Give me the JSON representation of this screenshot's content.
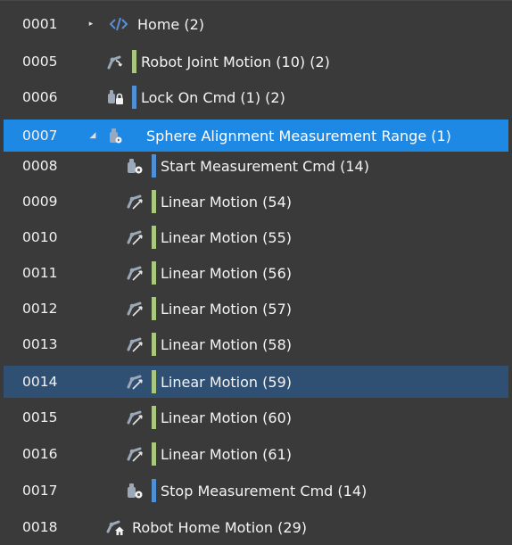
{
  "tree": {
    "rows": [
      {
        "line": "0001",
        "label": "Home (2)",
        "icon": "code-tag-icon",
        "expander": "collapsed",
        "bar_color": ""
      },
      {
        "line": "0005",
        "label": "Robot Joint Motion (10) (2)",
        "icon": "joint-motion-icon",
        "expander": "",
        "bar_color": "#a9c77f"
      },
      {
        "line": "0006",
        "label": "Lock On Cmd (1) (2)",
        "icon": "lock-cmd-icon",
        "expander": "",
        "bar_color": "#4f8fd6"
      },
      {
        "line": "0007",
        "label": "Sphere Alignment Measurement Range (1)",
        "icon": "measurement-range-icon",
        "expander": "expanded",
        "bar_color": "#1e88e5",
        "state": "selected"
      },
      {
        "line": "0008",
        "label": "Start Measurement Cmd (14)",
        "icon": "measurement-cmd-icon",
        "expander": "",
        "bar_color": "#4f8fd6"
      },
      {
        "line": "0009",
        "label": "Linear Motion (54)",
        "icon": "linear-motion-icon",
        "expander": "",
        "bar_color": "#a9c77f"
      },
      {
        "line": "0010",
        "label": "Linear Motion (55)",
        "icon": "linear-motion-icon",
        "expander": "",
        "bar_color": "#a9c77f"
      },
      {
        "line": "0011",
        "label": "Linear Motion (56)",
        "icon": "linear-motion-icon",
        "expander": "",
        "bar_color": "#a9c77f"
      },
      {
        "line": "0012",
        "label": "Linear Motion (57)",
        "icon": "linear-motion-icon",
        "expander": "",
        "bar_color": "#a9c77f"
      },
      {
        "line": "0013",
        "label": "Linear Motion (58)",
        "icon": "linear-motion-icon",
        "expander": "",
        "bar_color": "#a9c77f"
      },
      {
        "line": "0014",
        "label": "Linear Motion (59)",
        "icon": "linear-motion-icon",
        "expander": "",
        "bar_color": "#a9c77f",
        "state": "highlight"
      },
      {
        "line": "0015",
        "label": "Linear Motion (60)",
        "icon": "linear-motion-icon",
        "expander": "",
        "bar_color": "#a9c77f"
      },
      {
        "line": "0016",
        "label": "Linear Motion (61)",
        "icon": "linear-motion-icon",
        "expander": "",
        "bar_color": "#a9c77f"
      },
      {
        "line": "0017",
        "label": "Stop Measurement Cmd (14)",
        "icon": "measurement-cmd-icon",
        "expander": "",
        "bar_color": "#4f8fd6"
      },
      {
        "line": "0018",
        "label": "Robot Home Motion (29)",
        "icon": "home-motion-icon",
        "expander": "",
        "bar_color": ""
      }
    ]
  },
  "colors": {
    "background": "#3a3a3a",
    "selected": "#1e88e5",
    "highlight": "#2f4f73",
    "motion_bar": "#a9c77f",
    "command_bar": "#4f8fd6"
  }
}
